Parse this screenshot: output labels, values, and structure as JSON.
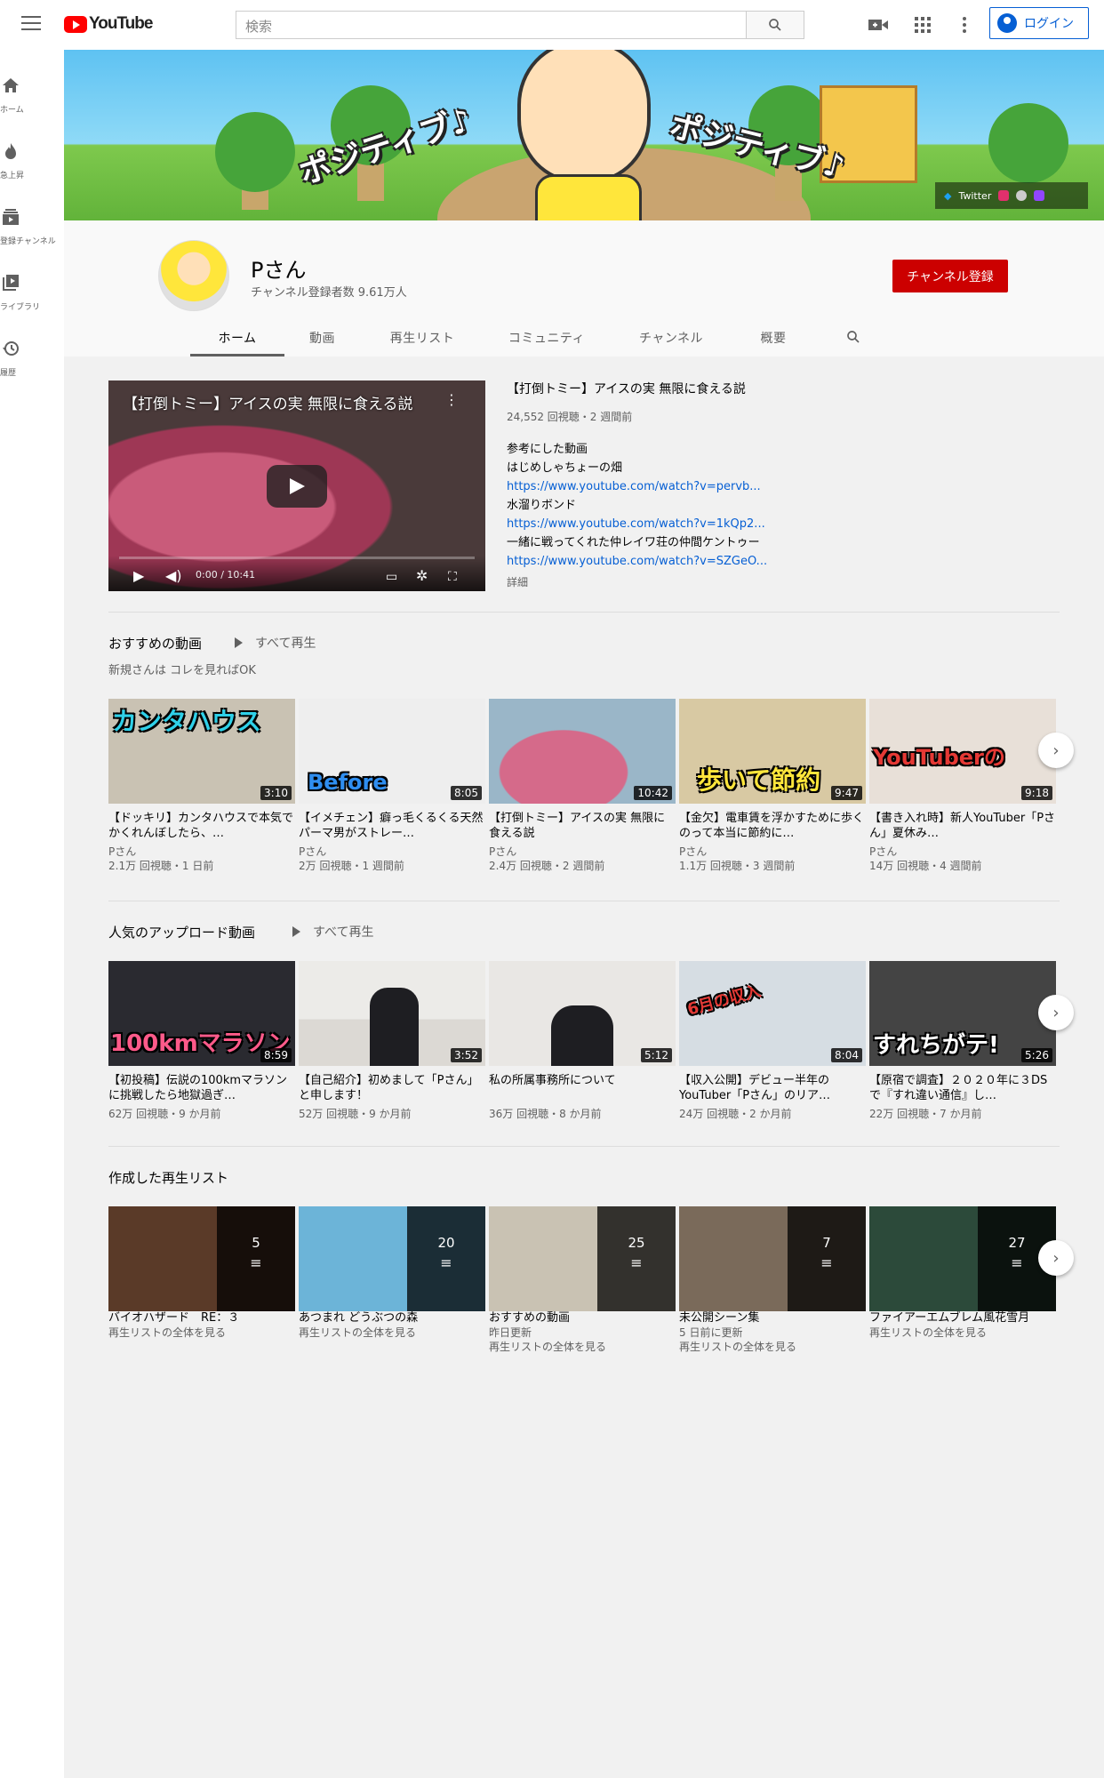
{
  "header": {
    "logo_text": "YouTube",
    "search_placeholder": "検索",
    "login_label": "ログイン"
  },
  "guide": [
    {
      "label": "ホーム",
      "icon": "home-icon"
    },
    {
      "label": "急上昇",
      "icon": "trending-icon"
    },
    {
      "label": "登録チャンネル",
      "icon": "subscriptions-icon"
    },
    {
      "label": "ライブラリ",
      "icon": "library-icon"
    },
    {
      "label": "履歴",
      "icon": "history-icon"
    }
  ],
  "banner": {
    "slogan_left": "ポジティブ♪",
    "slogan_right": "ポジティブ♪",
    "social_twitter": "Twitter"
  },
  "channel": {
    "name": "Pさん",
    "subscribers": "チャンネル登録者数 9.61万人",
    "subscribe_label": "チャンネル登録",
    "tabs": [
      "ホーム",
      "動画",
      "再生リスト",
      "コミュニティ",
      "チャンネル",
      "概要"
    ]
  },
  "featured": {
    "player_title": "【打倒トミー】アイスの実 無限に食える説",
    "time": "0:00 / 10:41",
    "progress": 0,
    "title": "【打倒トミー】アイスの実 無限に食える説",
    "meta": "24,552 回視聴・2 週間前",
    "desc1": "参考にした動画",
    "desc2": "はじめしゃちょーの畑",
    "link1": "https://www.youtube.com/watch?v=pervb...",
    "desc3": "水溜りボンド",
    "link2": "https://www.youtube.com/watch?v=1kQp2...",
    "desc4": "一緒に戦ってくれた仲レイワ荘の仲間ケントゥー",
    "link3": "https://www.youtube.com/watch?v=SZGeO...",
    "more": "詳細"
  },
  "shelf1": {
    "title": "おすすめの動画",
    "play_all": "すべて再生",
    "subtitle": "新規さんは コレを見ればOK",
    "videos": [
      {
        "title": "【ドッキリ】カンタハウスで本気でかくれんぼしたら、…",
        "channel": "Pさん",
        "meta": "2.1万 回視聴・1 日前",
        "duration": "3:10",
        "thumb_text": "カンタハウス",
        "bg": "#c9c2b3"
      },
      {
        "title": "【イメチェン】癖っ毛くるくる天然パーマ男がストレー…",
        "channel": "Pさん",
        "meta": "2万 回視聴・1 週間前",
        "duration": "8:05",
        "thumb_text": "Before",
        "bg": "#eeeeee"
      },
      {
        "title": "【打倒トミー】アイスの実 無限に食える説",
        "channel": "Pさん",
        "meta": "2.4万 回視聴・2 週間前",
        "duration": "10:42",
        "thumb_text": "",
        "bg": "#c95b7a"
      },
      {
        "title": "【金欠】電車賃を浮かすために歩くのって本当に節約に…",
        "channel": "Pさん",
        "meta": "1.1万 回視聴・3 週間前",
        "duration": "9:47",
        "thumb_text": "歩いて節約",
        "bg": "#d8c9a3"
      },
      {
        "title": "【書き入れ時】新人YouTuber「Pさん」夏休み…",
        "channel": "Pさん",
        "meta": "14万 回視聴・4 週間前",
        "duration": "9:18",
        "thumb_text": "YouTuberの",
        "bg": "#e8e0d8"
      }
    ]
  },
  "shelf2": {
    "title": "人気のアップロード動画",
    "play_all": "すべて再生",
    "videos": [
      {
        "title": "【初投稿】伝説の100kmマラソンに挑戦したら地獄過ぎ…",
        "meta": "62万 回視聴・9 か月前",
        "duration": "8:59",
        "thumb_text": "100kmマラソン",
        "bg": "#2a2a30"
      },
      {
        "title": "【自己紹介】初めまして「Pさん」と申します！",
        "meta": "52万 回視聴・9 か月前",
        "duration": "3:52",
        "thumb_text": "",
        "bg": "#e9e7e4"
      },
      {
        "title": "私の所属事務所について",
        "meta": "36万 回視聴・8 か月前",
        "duration": "5:12",
        "thumb_text": "",
        "bg": "#e9e7e4"
      },
      {
        "title": "【収入公開】デビュー半年のYouTuber「Pさん」のリア…",
        "meta": "24万 回視聴・2 か月前",
        "duration": "8:04",
        "thumb_text": "6月の収入",
        "bg": "#d6dde3"
      },
      {
        "title": "【原宿で調査】２０２０年に３DSで『すれ違い通信』し…",
        "meta": "22万 回視聴・7 か月前",
        "duration": "5:26",
        "thumb_text": "すれちがテ!",
        "bg": "#444444"
      }
    ]
  },
  "shelf3": {
    "title": "作成した再生リスト",
    "playlists": [
      {
        "title": "バイオハザード　RE：３",
        "sub1": "再生リストの全体を見る",
        "sub2": "",
        "count": "5",
        "bg": "#5a3a28"
      },
      {
        "title": "あつまれ どうぶつの森",
        "sub1": "再生リストの全体を見る",
        "sub2": "",
        "count": "20",
        "bg": "#6cb4d8"
      },
      {
        "title": "おすすめの動画",
        "sub1": "昨日更新",
        "sub2": "再生リストの全体を見る",
        "count": "25",
        "bg": "#c9c2b3"
      },
      {
        "title": "未公開シーン集",
        "sub1": "5 日前に更新",
        "sub2": "再生リストの全体を見る",
        "count": "7",
        "bg": "#7a6a5a"
      },
      {
        "title": "ファイアーエムブレム風花雪月",
        "sub1": "再生リストの全体を見る",
        "sub2": "",
        "count": "27",
        "bg": "#2c4a3a"
      }
    ]
  }
}
